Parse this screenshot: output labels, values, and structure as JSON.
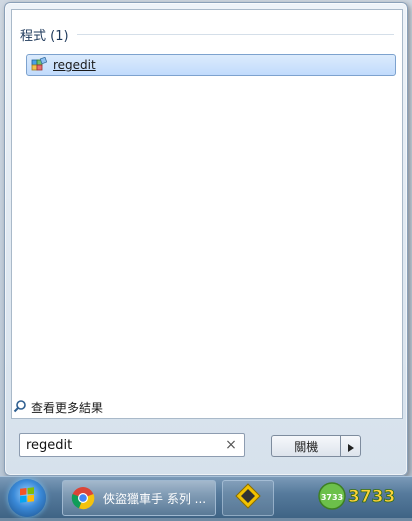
{
  "search_results": {
    "section_title": "程式 (1)",
    "items": [
      {
        "label": "regedit",
        "icon": "registry-editor-icon"
      }
    ]
  },
  "more_results": {
    "label": "查看更多結果",
    "icon": "search-icon"
  },
  "search_box": {
    "value": "regedit",
    "clear_icon": "×"
  },
  "shutdown": {
    "label": "關機",
    "arrow_icon": "triangle-right-icon"
  },
  "taskbar": {
    "items": [
      {
        "label": "俠盜獵車手 系列 ...",
        "icon": "chrome-icon"
      },
      {
        "label": "",
        "icon": "yellow-app-icon"
      }
    ],
    "tray_logo_text": "3733",
    "tray_badge_text": "3733"
  },
  "colors": {
    "accent": "#c1dbfc",
    "taskbar": "#567a9c"
  }
}
